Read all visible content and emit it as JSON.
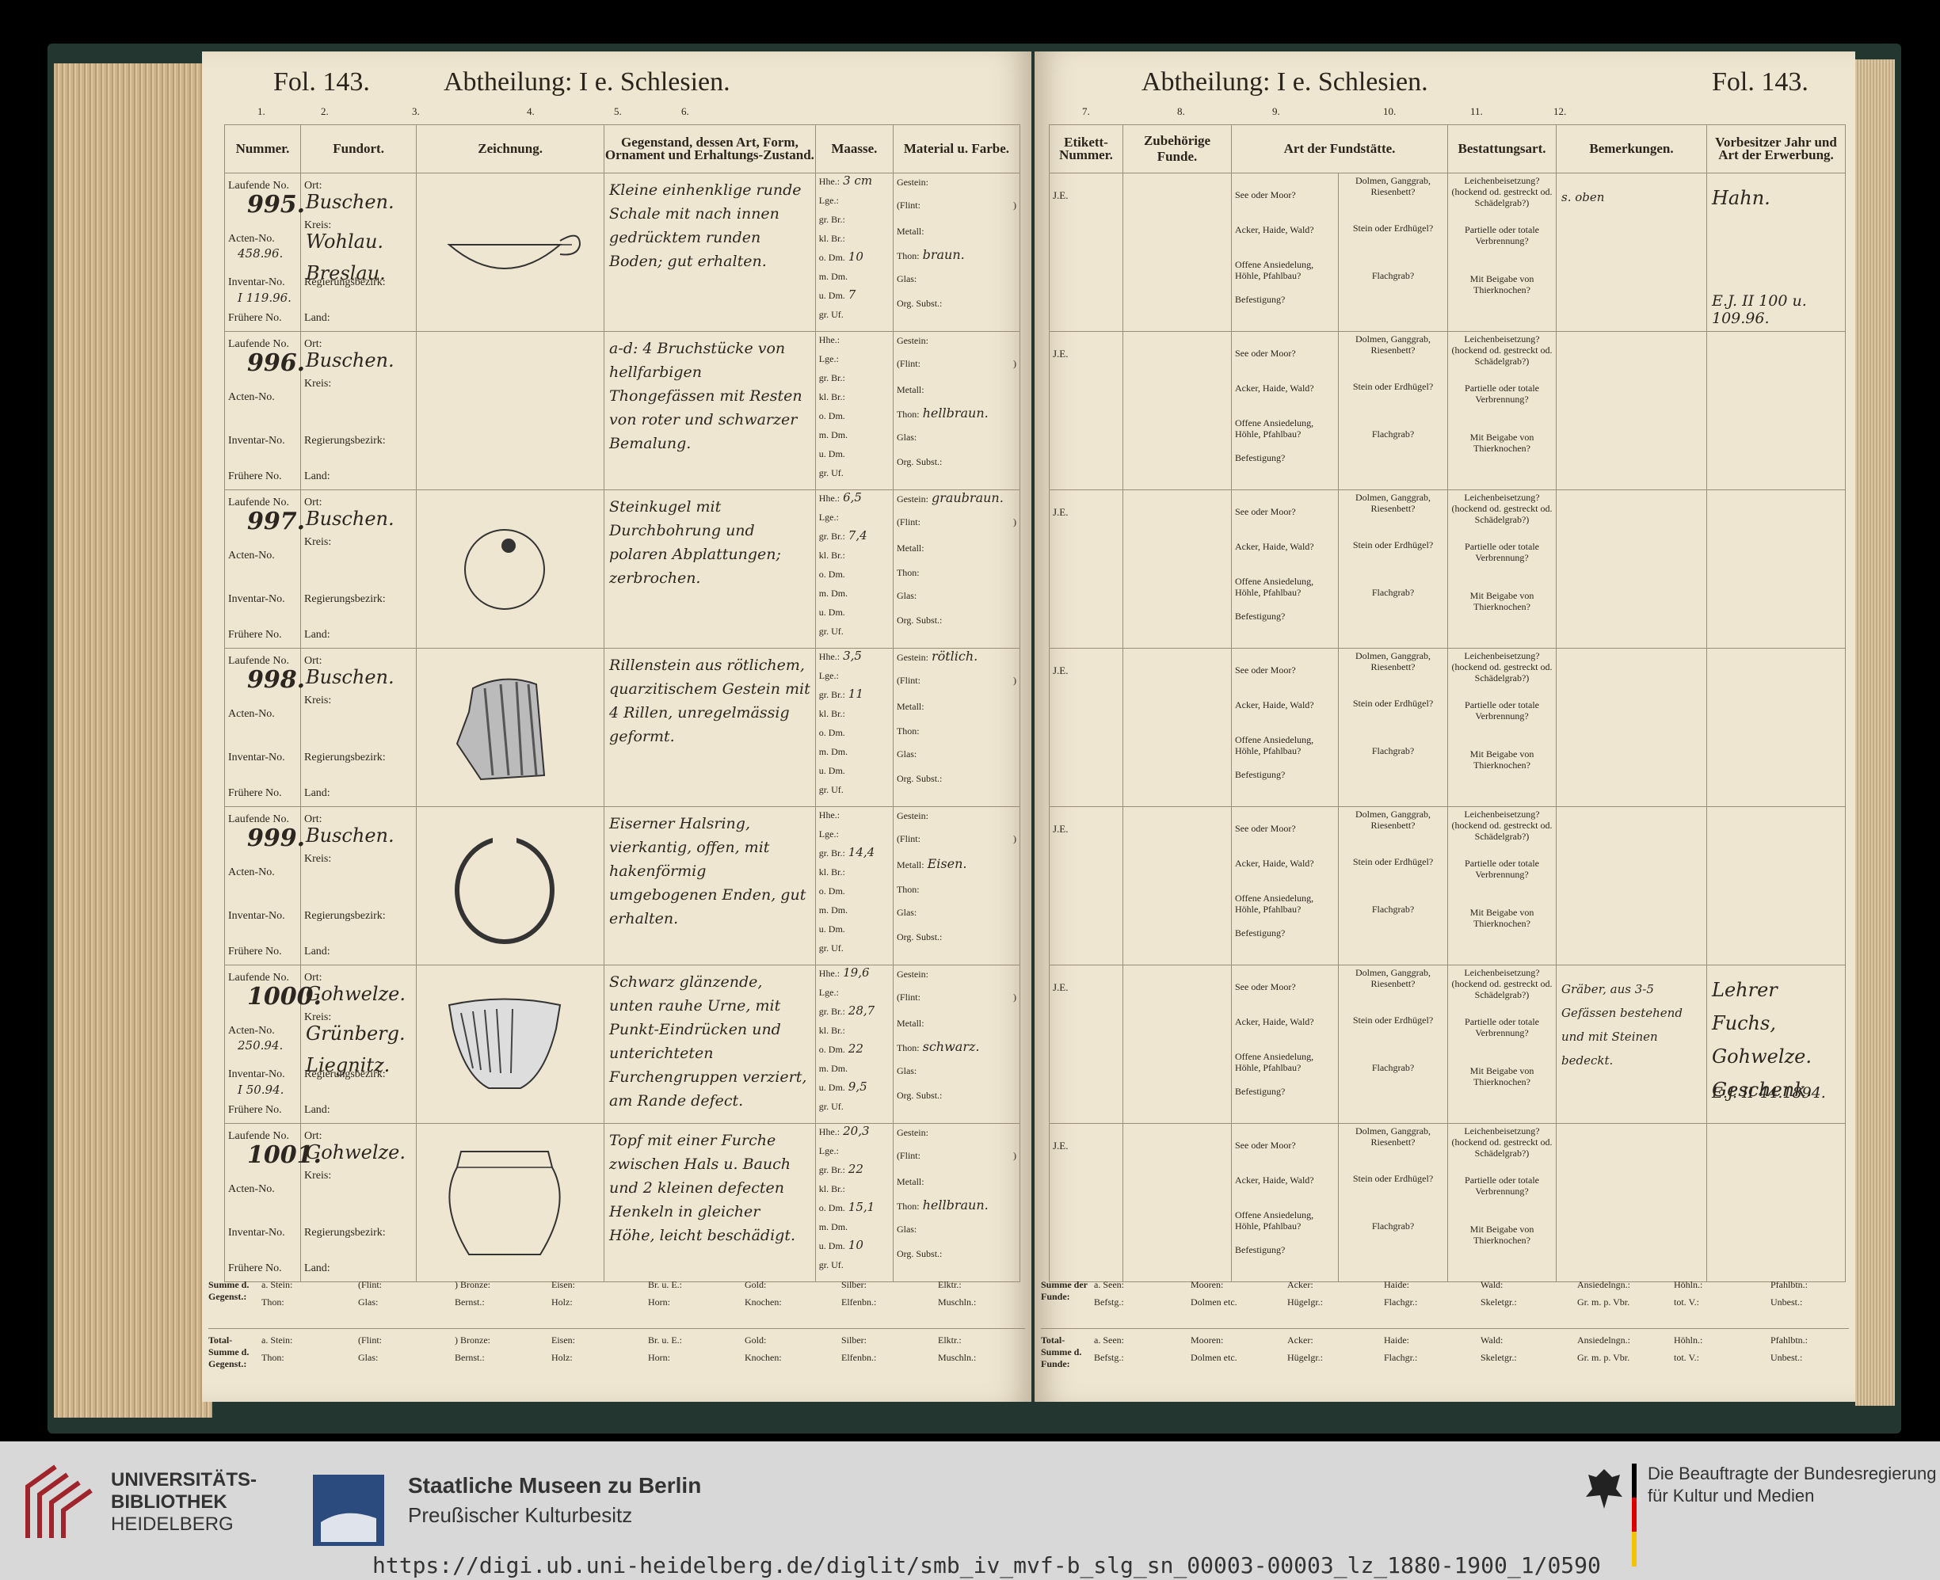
{
  "left_page": {
    "fol": "Fol. 143.",
    "abtheilung": "Abtheilung: I e. Schlesien.",
    "col_numbers": [
      "1.",
      "2.",
      "3.",
      "4.",
      "5.",
      "6."
    ],
    "headers": [
      "Nummer.",
      "Fundort.",
      "Zeichnung.",
      "Gegenstand, dessen Art, Form, Ornament und Erhaltungs-Zustand.",
      "Maasse.",
      "Material u. Farbe."
    ],
    "nummer_labels": [
      "Laufende No.",
      "Acten-No.",
      "Inventar-No.",
      "Frühere No."
    ],
    "fundort_labels": [
      "Ort:",
      "Kreis:",
      "Regierungsbezirk:",
      "Land:"
    ],
    "maasse_labels": [
      "Hhe.:",
      "Lge.:",
      "gr. Br.:",
      "kl. Br.:",
      "o. Dm.",
      "m. Dm.",
      "u. Dm.",
      "gr. Uf."
    ],
    "material_labels": [
      "Gestein:",
      "(Flint:",
      ")",
      "Metall:",
      "Thon:",
      "Glas:",
      "Org. Subst.:"
    ],
    "entries": [
      {
        "laufende": "995.",
        "acten": "458.96.",
        "inventar": "I 119.96.",
        "ort": "Buschen.",
        "kreis": "Wohlau.",
        "bezirk": "Breslau.",
        "desc": "Kleine einhenklige runde Schale mit nach innen gedrücktem runden Boden; gut erhalten.",
        "maasse": [
          "3 cm",
          "",
          "",
          "",
          "10",
          "",
          "7",
          ""
        ],
        "material": {
          "gestein": "",
          "thon": "braun."
        }
      },
      {
        "laufende": "996.",
        "acten": "",
        "inventar": "",
        "ort": "Buschen.",
        "kreis": "",
        "bezirk": "",
        "desc": "a-d: 4 Bruchstücke von hellfarbigen Thongefässen mit Resten von roter und schwarzer Bemalung.",
        "maasse": [
          "",
          "",
          "",
          "",
          "",
          "",
          "",
          ""
        ],
        "material": {
          "gestein": "",
          "thon": "hellbraun."
        }
      },
      {
        "laufende": "997.",
        "acten": "",
        "inventar": "",
        "ort": "Buschen.",
        "kreis": "",
        "bezirk": "",
        "desc": "Steinkugel mit Durchbohrung und polaren Abplattungen; zerbrochen.",
        "maasse": [
          "6,5",
          "",
          "7,4",
          "",
          "",
          "",
          "",
          ""
        ],
        "material": {
          "gestein": "graubraun.",
          "thon": ""
        }
      },
      {
        "laufende": "998.",
        "acten": "",
        "inventar": "",
        "ort": "Buschen.",
        "kreis": "",
        "bezirk": "",
        "desc": "Rillenstein aus rötlichem, quarzitischem Gestein mit 4 Rillen, unregelmässig geformt.",
        "maasse": [
          "3,5",
          "",
          "11",
          "",
          "",
          "",
          "",
          ""
        ],
        "material": {
          "gestein": "rötlich.",
          "thon": ""
        }
      },
      {
        "laufende": "999.",
        "acten": "",
        "inventar": "",
        "ort": "Buschen.",
        "kreis": "",
        "bezirk": "",
        "desc": "Eiserner Halsring, vierkantig, offen, mit hakenförmig umgebogenen Enden, gut erhalten.",
        "maasse": [
          "",
          "",
          "14,4",
          "",
          "",
          "",
          "",
          ""
        ],
        "material": {
          "gestein": "",
          "metall": "Eisen.",
          "thon": ""
        }
      },
      {
        "laufende": "1000.",
        "acten": "250.94.",
        "inventar": "I 50.94.",
        "ort": "Gohwelze.",
        "kreis": "Grünberg.",
        "bezirk": "Liegnitz.",
        "desc": "Schwarz glänzende, unten rauhe Urne, mit Punkt-Eindrücken und unterichteten Furchengruppen verziert, am Rande defect.",
        "maasse": [
          "19,6",
          "",
          "28,7",
          "",
          "22",
          "",
          "9,5",
          ""
        ],
        "material": {
          "gestein": "",
          "thon": "schwarz."
        }
      },
      {
        "laufende": "1001.",
        "acten": "",
        "inventar": "",
        "ort": "Gohwelze.",
        "kreis": "",
        "bezirk": "",
        "desc": "Topf mit einer Furche zwischen Hals u. Bauch und 2 kleinen defecten Henkeln in gleicher Höhe, leicht beschädigt.",
        "maasse": [
          "20,3",
          "",
          "22",
          "",
          "15,1",
          "",
          "10",
          ""
        ],
        "material": {
          "gestein": "",
          "thon": "hellbraun."
        }
      }
    ],
    "sums": {
      "summe_label": "Summe d. Gegenst.:",
      "total_label": "Total-Summe d. Gegenst.:",
      "row1": [
        "a. Stein:",
        "(Flint:",
        ") Bronze:",
        "Eisen:",
        "Br. u. E.:",
        "Gold:",
        "Silber:",
        "Elktr.:"
      ],
      "row2": [
        "Thon:",
        "Glas:",
        "Bernst.:",
        "Holz:",
        "Horn:",
        "Knochen:",
        "Elfenbn.:",
        "Muschln.:"
      ]
    }
  },
  "right_page": {
    "abtheilung": "Abtheilung: I e. Schlesien.",
    "fol": "Fol. 143.",
    "col_numbers": [
      "7.",
      "8.",
      "9.",
      "10.",
      "11.",
      "12."
    ],
    "headers": [
      "Etikett-Nummer.",
      "Zubehörige Funde.",
      "Art der Fundstätte.",
      "Bestattungsart.",
      "Bemerkungen.",
      "Vorbesitzer Jahr und Art der Erwerbung."
    ],
    "fund_labels_a": [
      "See oder Moor?",
      "Acker, Haide, Wald?",
      "Offene Ansiedelung, Höhle, Pfahlbau?",
      "Befestigung?"
    ],
    "fund_labels_b": [
      "Dolmen, Ganggrab, Riesenbett?",
      "Stein oder Erdhügel?",
      "Flachgrab?"
    ],
    "bestattung_labels": [
      "Leichenbeisetzung? (hockend od. gestreckt od. Schädelgrab?)",
      "Partielle oder totale Verbrennung?",
      "Mit Beigabe von Thierknochen?"
    ],
    "etikett_mark": "J.E.",
    "entries": [
      {
        "bemerk": "s. oben",
        "vorbesitzer": "Hahn.",
        "erwerb": "E.J. II 100 u. 109.96."
      },
      {
        "bemerk": "",
        "vorbesitzer": "",
        "erwerb": ""
      },
      {
        "bemerk": "",
        "vorbesitzer": "",
        "erwerb": ""
      },
      {
        "bemerk": "",
        "vorbesitzer": "",
        "erwerb": ""
      },
      {
        "bemerk": "",
        "vorbesitzer": "",
        "erwerb": ""
      },
      {
        "bemerk": "Gräber, aus 3-5 Gefässen bestehend und mit Steinen bedeckt.",
        "vorbesitzer": "Lehrer Fuchs, Gohwelze. Geschenk.",
        "erwerb": "E.J. II 44.1894."
      },
      {
        "bemerk": "",
        "vorbesitzer": "",
        "erwerb": ""
      }
    ],
    "sums": {
      "summe_label": "Summe der Funde:",
      "total_label": "Total-Summe d. Funde:",
      "row1": [
        "a. Seen:",
        "Mooren:",
        "Acker:",
        "Haide:",
        "Wald:",
        "Ansiedelngn.:",
        "Höhln.:",
        "Pfahlbtn.:"
      ],
      "row2": [
        "Befstg.:",
        "Dolmen etc.",
        "Hügelgr.:",
        "Flachgr.:",
        "Skeletgr.:",
        "Gr. m. p. Vbr.",
        "tot. V.:",
        "Unbest.:"
      ]
    }
  },
  "footer": {
    "uni_line1": "UNIVERSITÄTS-",
    "uni_line2": "BIBLIOTHEK",
    "uni_line3": "HEIDELBERG",
    "smb_line1": "Staatliche Museen zu Berlin",
    "smb_line2": "Preußischer Kulturbesitz",
    "bkm_line1": "Die Beauftragte der Bundesregierung",
    "bkm_line2": "für Kultur und Medien",
    "url": "https://digi.ub.uni-heidelberg.de/diglit/smb_iv_mvf-b_slg_sn_00003-00003_lz_1880-1900_1/0590"
  },
  "colors": {
    "paper": "#efe6d2",
    "cover": "#23362f",
    "ink": "#2a241c",
    "footer": "#d8d8d8"
  }
}
